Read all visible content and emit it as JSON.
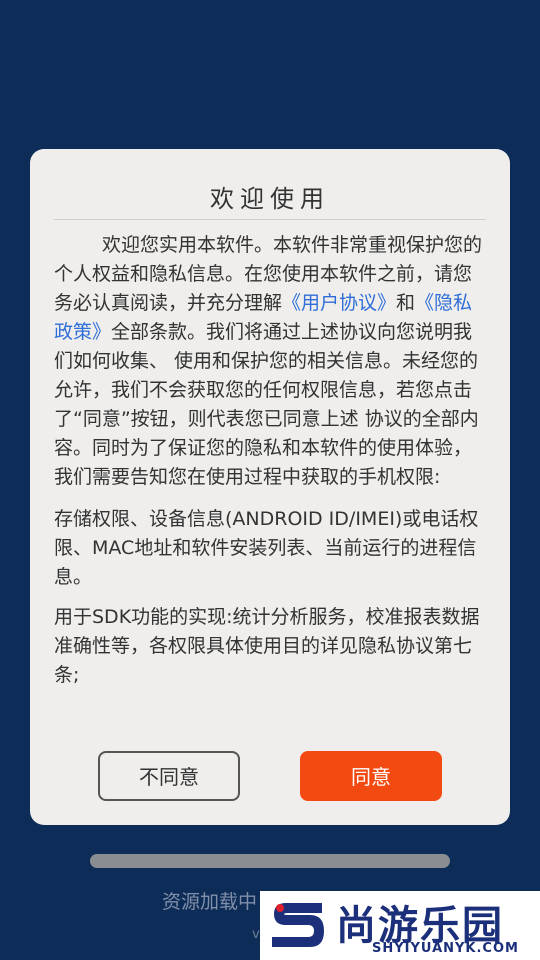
{
  "dialog": {
    "title": "欢迎使用",
    "para1_a": "欢迎您实用本软件。本软件非常重视保护您的个人权益和隐私信息。在您使用本软件之前，请您务必认真阅读，并充分理解",
    "link_user_agreement": "《用户协议》",
    "para1_and": "和",
    "link_privacy_policy": "《隐私政策》",
    "para1_b": "全部条款。我们将通过上述协议向您说明我们如何收集、 使用和保护您的相关信息。未经您的允许，我们不会获取您的任何权限信息，若您点击了“同意”按钮，则代表您已同意上述 协议的全部内容。同时为了保证您的隐私和本软件的使用体验，我们需要告知您在使用过程中获取的手机权限:",
    "para2": "存储权限、设备信息(ANDROID ID/IMEI)或电话权限、MAC地址和软件安装列表、当前运行的进程信息。",
    "para3": "用于SDK功能的实现:统计分析服务，校准报表数据准确性等，各权限具体使用目的详见隐私协议第七条;",
    "disagree_label": "不同意",
    "agree_label": "同意"
  },
  "loading": {
    "text": "资源加载中",
    "version": "v"
  },
  "watermark": {
    "title": "尚游乐园",
    "subtitle": "SHYIYUANYK.COM"
  },
  "colors": {
    "background": "#0d2c58",
    "dialog": "#efeeec",
    "link": "#2f6ed8",
    "agree": "#f34a12"
  }
}
